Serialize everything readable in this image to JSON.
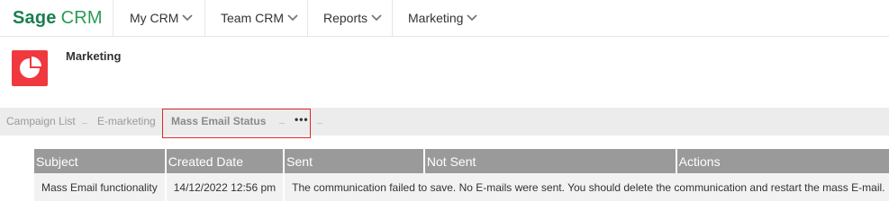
{
  "brand": {
    "name_primary": "Sage",
    "name_secondary": "CRM",
    "colors": {
      "primary": "#1a7f4f",
      "secondary": "#2b9c55"
    }
  },
  "nav": {
    "items": [
      {
        "label": "My CRM",
        "icon": "chevron-down-icon"
      },
      {
        "label": "Team CRM",
        "icon": "chevron-down-icon"
      },
      {
        "label": "Reports",
        "icon": "chevron-down-icon"
      },
      {
        "label": "Marketing",
        "icon": "chevron-down-icon"
      }
    ]
  },
  "entity": {
    "title": "Marketing",
    "icon": "pie-chart-icon",
    "icon_color": "#f0393e"
  },
  "tabs": {
    "items": [
      {
        "label": "Campaign List"
      },
      {
        "label": "E-marketing"
      },
      {
        "label": "Mass Email Status",
        "active": true
      },
      {
        "label": "•••"
      }
    ],
    "highlight_color": "#e0262b"
  },
  "table": {
    "headers": [
      "Subject",
      "Created Date",
      "Sent",
      "Not Sent",
      "Actions"
    ],
    "rows": [
      {
        "subject": "Mass Email functionality",
        "created_date": "14/12/2022 12:56 pm",
        "message": "The communication failed to save. No E-mails were sent. You should delete the communication and restart the mass E-mail."
      }
    ]
  }
}
